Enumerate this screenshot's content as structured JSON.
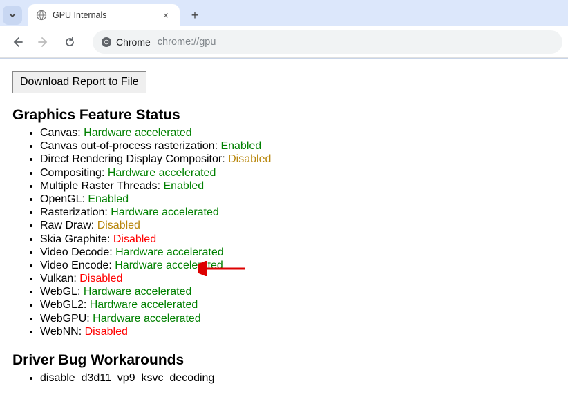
{
  "browser": {
    "tab_title": "GPU Internals",
    "chrome_label": "Chrome",
    "url": "chrome://gpu"
  },
  "page": {
    "download_button": "Download Report to File",
    "sections": {
      "graphics_feature_status": {
        "heading": "Graphics Feature Status",
        "items": [
          {
            "label": "Canvas",
            "status": "Hardware accelerated",
            "class": "green"
          },
          {
            "label": "Canvas out-of-process rasterization",
            "status": "Enabled",
            "class": "green"
          },
          {
            "label": "Direct Rendering Display Compositor",
            "status": "Disabled",
            "class": "yellow"
          },
          {
            "label": "Compositing",
            "status": "Hardware accelerated",
            "class": "green"
          },
          {
            "label": "Multiple Raster Threads",
            "status": "Enabled",
            "class": "green"
          },
          {
            "label": "OpenGL",
            "status": "Enabled",
            "class": "green"
          },
          {
            "label": "Rasterization",
            "status": "Hardware accelerated",
            "class": "green"
          },
          {
            "label": "Raw Draw",
            "status": "Disabled",
            "class": "yellow"
          },
          {
            "label": "Skia Graphite",
            "status": "Disabled",
            "class": "red"
          },
          {
            "label": "Video Decode",
            "status": "Hardware accelerated",
            "class": "green"
          },
          {
            "label": "Video Encode",
            "status": "Hardware accelerated",
            "class": "green"
          },
          {
            "label": "Vulkan",
            "status": "Disabled",
            "class": "red"
          },
          {
            "label": "WebGL",
            "status": "Hardware accelerated",
            "class": "green"
          },
          {
            "label": "WebGL2",
            "status": "Hardware accelerated",
            "class": "green"
          },
          {
            "label": "WebGPU",
            "status": "Hardware accelerated",
            "class": "green"
          },
          {
            "label": "WebNN",
            "status": "Disabled",
            "class": "red"
          }
        ]
      },
      "driver_bug_workarounds": {
        "heading": "Driver Bug Workarounds",
        "items": [
          "disable_d3d11_vp9_ksvc_decoding"
        ]
      }
    }
  }
}
